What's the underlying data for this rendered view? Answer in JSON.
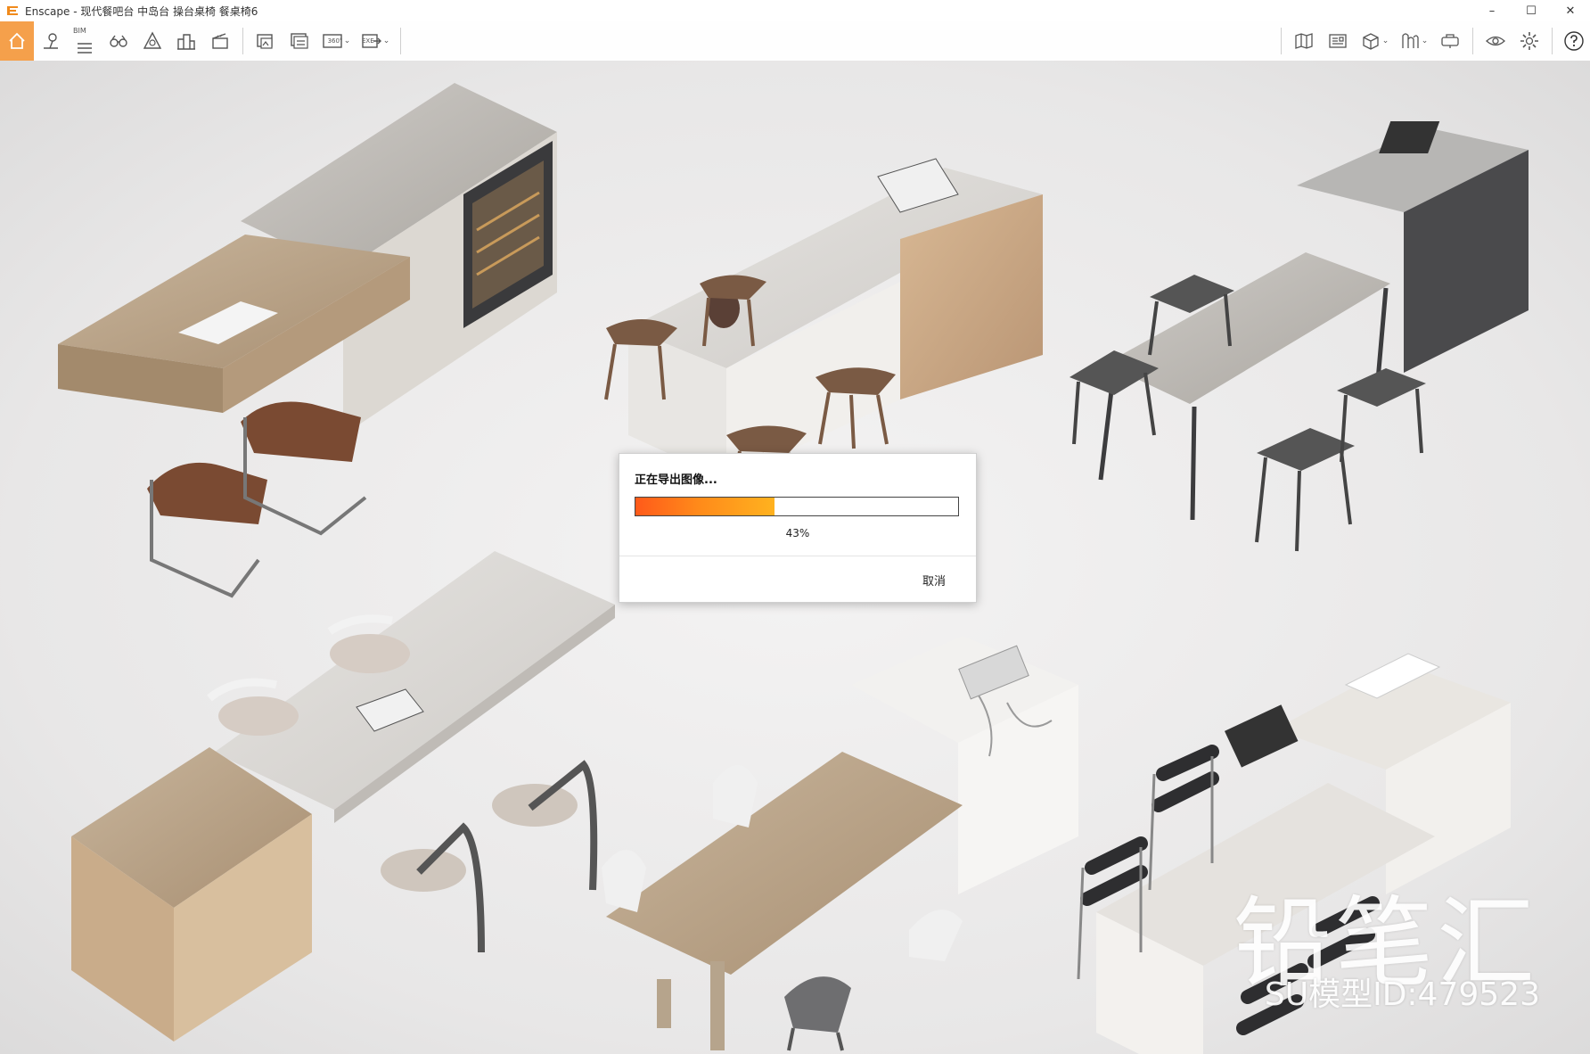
{
  "window": {
    "title": "Enscape - 现代餐吧台 中岛台 操台桌椅 餐桌椅6",
    "controls": {
      "minimize": "–",
      "maximize": "☐",
      "close": "✕"
    }
  },
  "toolbar": {
    "bim_label": "BIM",
    "panorama_label": "360°",
    "exe_label": "EXE",
    "collapse_caret": "^",
    "dropdown_glyph": "⌄",
    "accent_color": "#f5a04b"
  },
  "export_dialog": {
    "title": "正在导出图像...",
    "progress_percent": 43,
    "progress_label": "43%",
    "cancel_label": "取消"
  },
  "watermark": {
    "brand": "铅笔汇",
    "model_id": "SU模型ID:479523"
  }
}
